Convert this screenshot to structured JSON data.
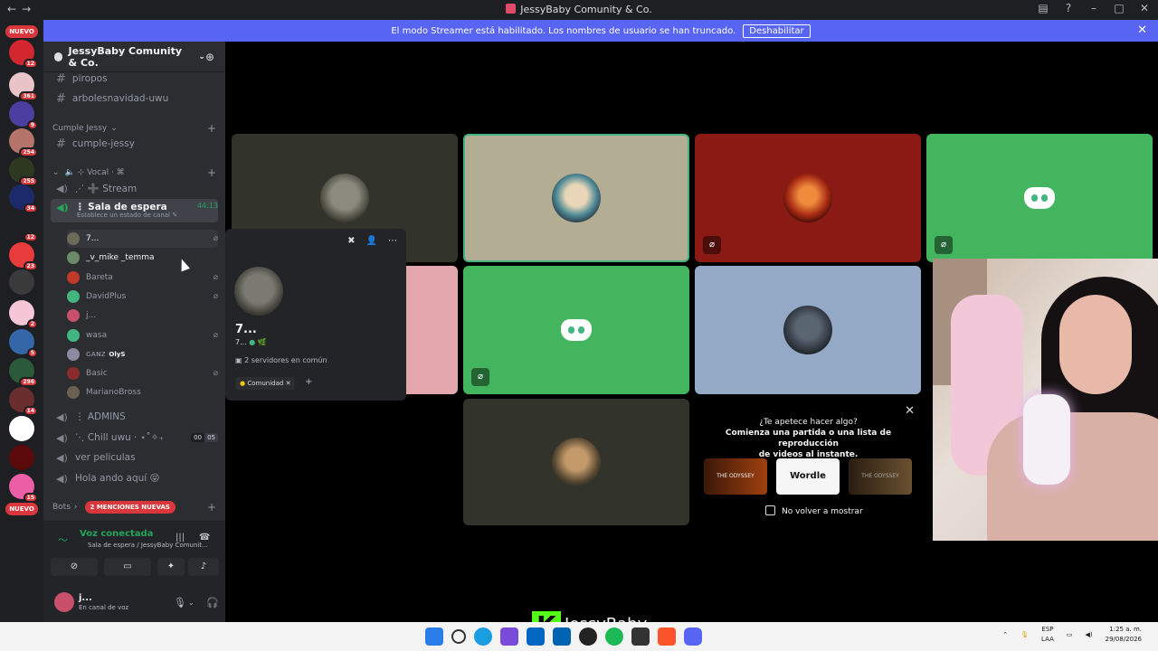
{
  "window": {
    "title": "JessyBaby Comunity & Co.",
    "nav_back": "←",
    "nav_fwd": "→",
    "btn_inbox": "▤",
    "btn_help": "?",
    "btn_min": "–",
    "btn_max": "□",
    "btn_close": "✕"
  },
  "banner": {
    "text": "El modo Streamer está habilitado. Los nombres de usuario se han truncado.",
    "button": "Deshabilitar",
    "close": "✕"
  },
  "rail": {
    "new_top": "NUEVO",
    "new_bottom": "NUEVO",
    "servers": [
      {
        "count": "12",
        "color": "#d2272f"
      },
      {
        "count": "361",
        "color": "#e8c4c8"
      },
      {
        "count": "9",
        "color": "#4a3fa0"
      },
      {
        "count": "254",
        "color": "#b4746a"
      },
      {
        "count": "255",
        "color": "#2e3820"
      },
      {
        "count": "34",
        "color": "#1c2a6a"
      },
      {
        "count": "12",
        "color": "#1e1f22"
      },
      {
        "count": "23",
        "color": "#e83c3c"
      },
      {
        "count": "",
        "color": "#3a3a3a"
      },
      {
        "count": "2",
        "color": "#f4c6d6"
      },
      {
        "count": "5",
        "color": "#3466a8"
      },
      {
        "count": "296",
        "color": "#2a5a3a"
      },
      {
        "count": "14",
        "color": "#6a2e2e"
      },
      {
        "count": "",
        "color": "#fff"
      },
      {
        "count": "",
        "color": "#5a0a0a"
      },
      {
        "count": "15",
        "color": "#ec5fa6"
      }
    ]
  },
  "sidebar": {
    "server_name": "JessyBaby Comunity & Co.",
    "text_channels_top": [
      "piropos",
      "arbolesnavidad-uwu"
    ],
    "category_cumple": "Cumple Jessy",
    "channel_cumple": "cumple-jessy",
    "category_vocal": "⊹ Vocal ⋅ ⌘",
    "channel_stream": "⋰ ➕ Stream",
    "active_channel": "⋮ Sala de espera",
    "active_timer": "44:13",
    "active_status": "Establece un estado de canal ✎",
    "voice_users": [
      {
        "name": "7...",
        "color": "#6e6a5a",
        "muted": true
      },
      {
        "name": "_v_mike _temma",
        "color": "#6a8a6a",
        "muted": false
      },
      {
        "name": "Bareta",
        "color": "#c0392b",
        "muted": true
      },
      {
        "name": "DavidPlus",
        "color": "#43b581",
        "muted": true
      },
      {
        "name": "j...",
        "color": "#c9506a",
        "muted": false
      },
      {
        "name": "wasa",
        "color": "#43b581",
        "muted": true
      },
      {
        "name": "ɢᴀɴᴢ",
        "color": "#8d8aa0",
        "muted": false,
        "extra": "OlyS"
      },
      {
        "name": "Basic",
        "color": "#8b2c2c",
        "muted": true
      },
      {
        "name": "MarianoBross",
        "color": "#6a6050",
        "muted": false
      }
    ],
    "channel_admins": "⋮ ADMINS",
    "channel_chill": "⋱ Chill uwu ⋅ ⋆˚✧₊",
    "chill_counts": [
      "00",
      "05"
    ],
    "channel_peliculas": "ver peliculas",
    "channel_hola": "Hola ando aquí 😝",
    "category_bots": "Bots",
    "mentions_pill": "2 MENCIONES NUEVAS"
  },
  "voice_panel": {
    "title": "Voz conectada",
    "subtitle": "Sala de espera / JessyBaby Comunit...",
    "user_name": "j...",
    "user_status": "En canal de voz"
  },
  "popout": {
    "name": "7...",
    "sub": "7...",
    "mutual": "2 servidores en común",
    "role": "Comunidad",
    "add": "+"
  },
  "activity": {
    "question": "¿Te apetece hacer algo?",
    "line2": "Comienza una partida o una lista de reproducción",
    "line3": "de videos al instante.",
    "cards": [
      "THE ODYSSEY",
      "Wordle",
      "THE ODYSSEY"
    ],
    "checkbox": "No volver a mostrar"
  },
  "taskbar": {
    "lang1": "ESP",
    "lang2": "LAA",
    "time": "1:25 a. m.",
    "date": "29/08/2026"
  },
  "watermark": {
    "k": "K",
    "text": "JessyBaby"
  }
}
